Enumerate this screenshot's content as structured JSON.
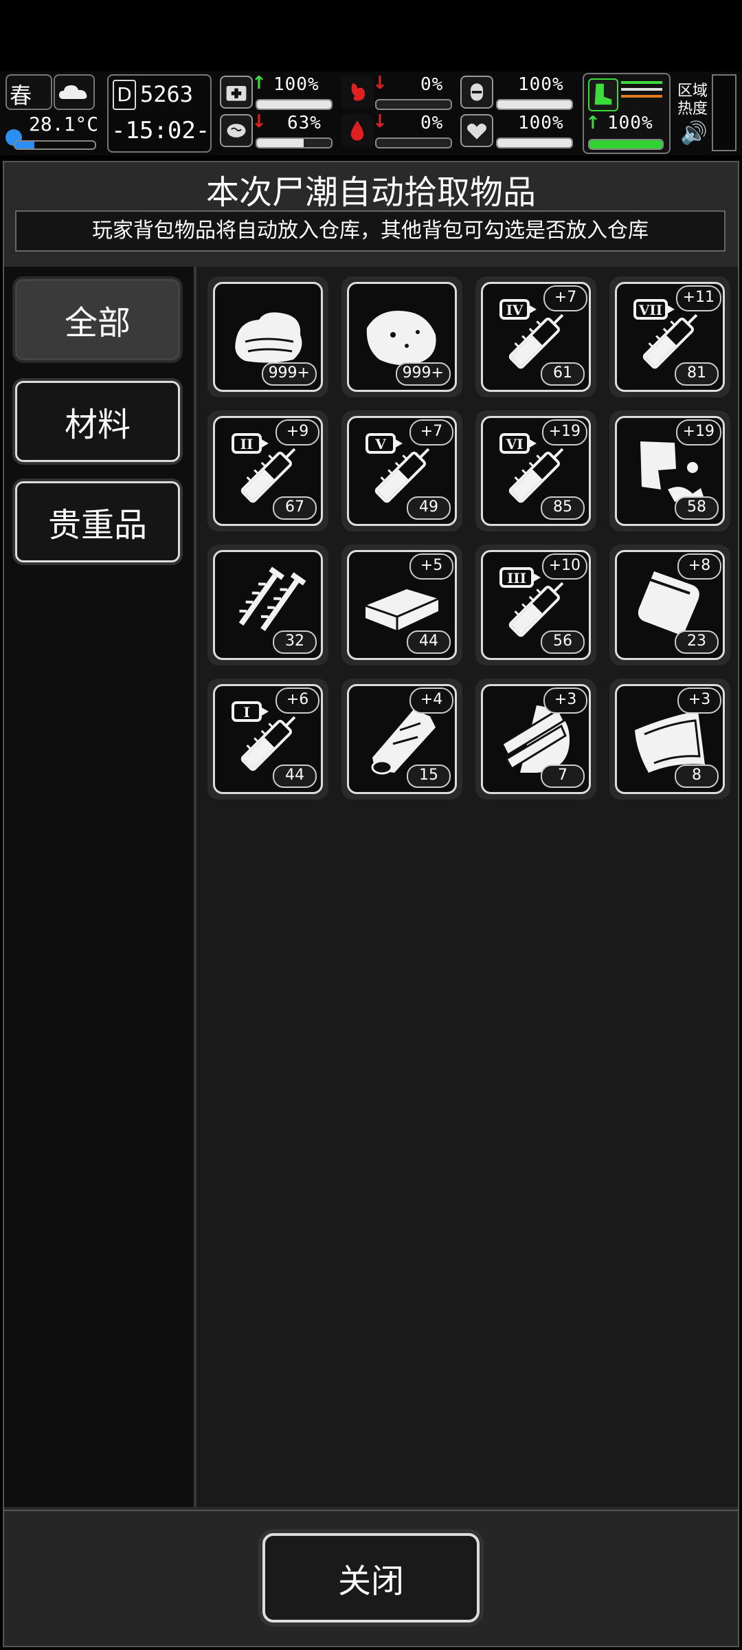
{
  "hud": {
    "season": "春",
    "temperature": "28.1°C",
    "day": "5263",
    "time": "-15:02-",
    "stats": [
      {
        "icon": "first-aid-icon",
        "value": "100%",
        "fill": 1.0,
        "trend": "up"
      },
      {
        "icon": "stomach-icon",
        "value": "0%",
        "fill": 0.0,
        "trend": "down"
      },
      {
        "icon": "bladder-icon",
        "value": "100%",
        "fill": 1.0,
        "trend": "none"
      },
      {
        "icon": "brain-icon",
        "value": "63%",
        "fill": 0.63,
        "trend": "down"
      },
      {
        "icon": "blood-drop-icon",
        "value": "0%",
        "fill": 0.0,
        "trend": "down"
      },
      {
        "icon": "heart-icon",
        "value": "100%",
        "fill": 1.0,
        "trend": "none"
      }
    ],
    "stamina": "100%",
    "zone_heat": "区域\n热度"
  },
  "title": "本次尸潮自动拾取物品",
  "subtitle": "玩家背包物品将自动放入仓库，其他背包可勾选是否放入仓库",
  "tabs": [
    "全部",
    "材料",
    "贵重品"
  ],
  "items": [
    {
      "icon": "cloth-icon",
      "count": "999+",
      "plus": ""
    },
    {
      "icon": "meat-chunk-icon",
      "count": "999+",
      "plus": ""
    },
    {
      "icon": "syringe-iv-icon",
      "numeral": "IV",
      "count": "61",
      "plus": "+7"
    },
    {
      "icon": "syringe-vii-icon",
      "numeral": "VII",
      "count": "81",
      "plus": "+11"
    },
    {
      "icon": "syringe-ii-icon",
      "numeral": "II",
      "count": "67",
      "plus": "+9"
    },
    {
      "icon": "syringe-v-icon",
      "numeral": "V",
      "count": "49",
      "plus": "+7"
    },
    {
      "icon": "syringe-vi-icon",
      "numeral": "VI",
      "count": "85",
      "plus": "+19"
    },
    {
      "icon": "scrap-metal-icon",
      "count": "58",
      "plus": "+19"
    },
    {
      "icon": "screws-icon",
      "count": "32",
      "plus": ""
    },
    {
      "icon": "brick-icon",
      "count": "44",
      "plus": "+5"
    },
    {
      "icon": "syringe-iii-icon",
      "numeral": "III",
      "count": "56",
      "plus": "+10"
    },
    {
      "icon": "plastic-bag-icon",
      "count": "23",
      "plus": "+8"
    },
    {
      "icon": "syringe-i-icon",
      "numeral": "I",
      "count": "44",
      "plus": "+6"
    },
    {
      "icon": "wood-log-icon",
      "count": "15",
      "plus": "+4"
    },
    {
      "icon": "planks-icon",
      "count": "7",
      "plus": "+3"
    },
    {
      "icon": "leather-icon",
      "count": "8",
      "plus": "+3"
    }
  ],
  "close_label": "关闭"
}
